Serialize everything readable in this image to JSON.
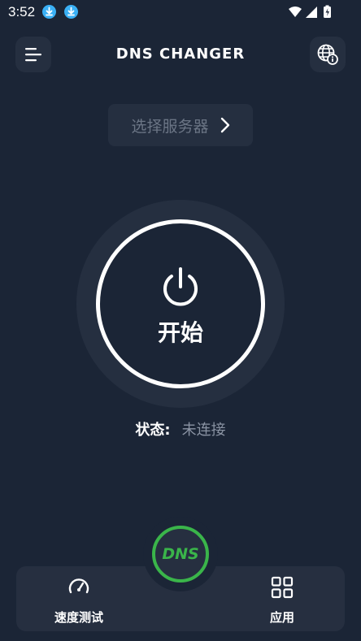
{
  "status_bar": {
    "time": "3:52",
    "notification_icons": [
      "download-icon",
      "download-icon"
    ],
    "system_icons": [
      "wifi-icon",
      "signal-icon",
      "battery-icon"
    ]
  },
  "header": {
    "title": "DNS CHANGER",
    "menu_icon": "menu-icon",
    "globe_icon": "globe-info-icon"
  },
  "server_selector": {
    "label": "选择服务器",
    "icon": "chevron-right-icon"
  },
  "power": {
    "label": "开始",
    "icon": "power-icon"
  },
  "status": {
    "key": "状态:",
    "value": "未连接"
  },
  "bottom_nav": {
    "items": [
      {
        "label": "速度测试",
        "icon": "speedometer-icon"
      },
      {
        "label": "应用",
        "icon": "grid-icon"
      }
    ],
    "center": {
      "label": "DNS"
    }
  },
  "colors": {
    "background": "#1b2536",
    "card": "#252f40",
    "accent_green": "#3ab54a",
    "download_blue": "#3ab0f5"
  }
}
